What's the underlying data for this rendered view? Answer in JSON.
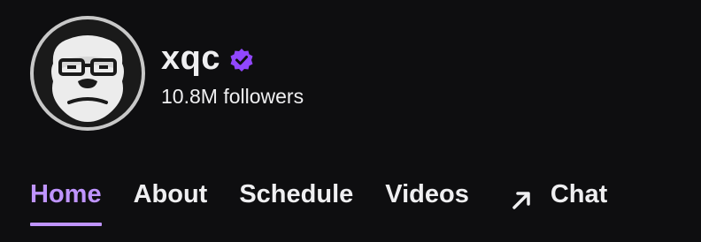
{
  "channel": {
    "name": "xqc",
    "followers": "10.8M followers",
    "verified": true,
    "avatar_icon": "gorilla-with-glasses-avatar"
  },
  "tabs": [
    {
      "label": "Home",
      "active": true
    },
    {
      "label": "About",
      "active": false
    },
    {
      "label": "Schedule",
      "active": false
    },
    {
      "label": "Videos",
      "active": false
    },
    {
      "label": "Chat",
      "active": false,
      "icon": "external-arrow-icon"
    }
  ],
  "colors": {
    "background": "#0e0e10",
    "text": "#efeff1",
    "accent": "#bf94ff",
    "verified_badge": "#9147ff"
  }
}
